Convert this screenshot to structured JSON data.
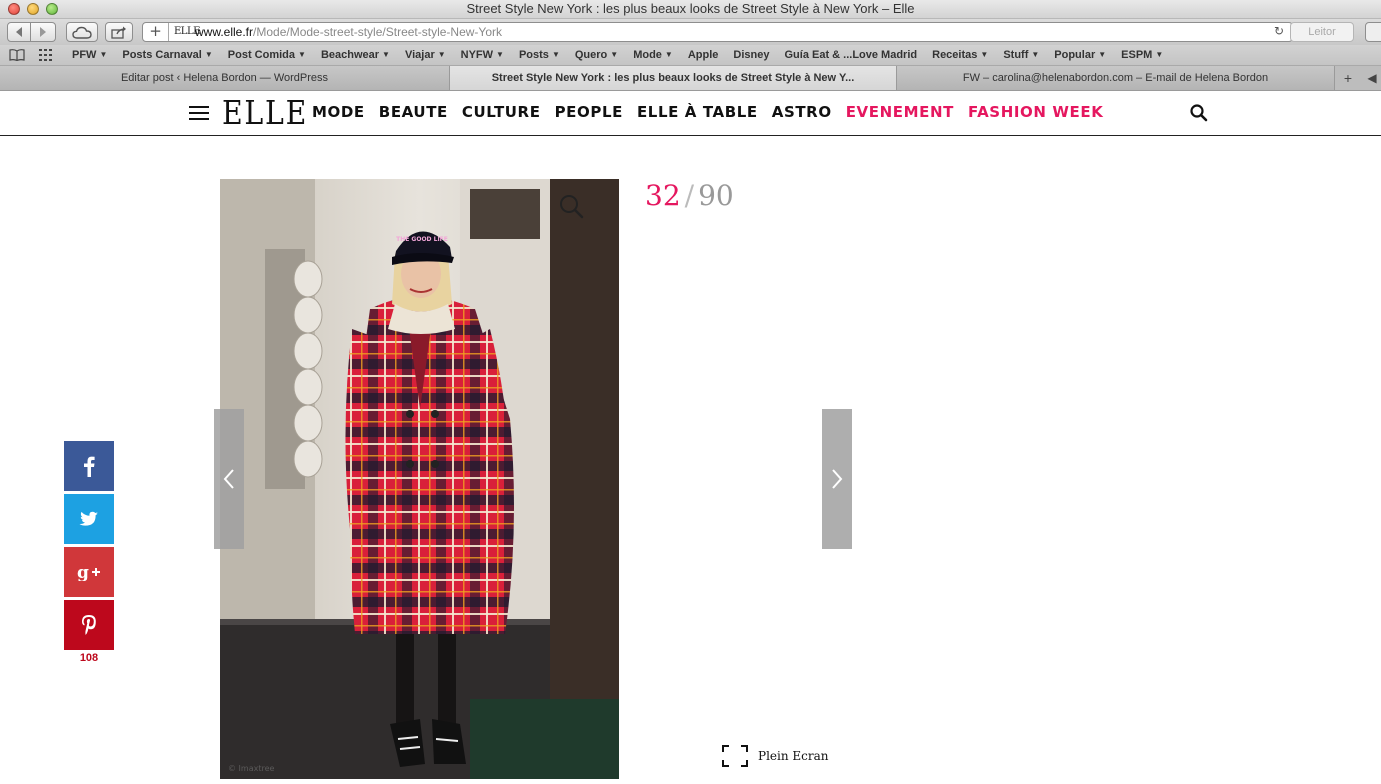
{
  "window": {
    "title": "Street Style New York : les plus beaux looks de Street Style à New York – Elle"
  },
  "browser": {
    "url_favicon": "ELLE",
    "url_domain": "www.elle.fr",
    "url_path": "/Mode/Mode-street-style/Street-style-New-York",
    "reader_label": "Leitor",
    "bookmarks": [
      {
        "label": "PFW",
        "menu": true
      },
      {
        "label": "Posts Carnaval",
        "menu": true
      },
      {
        "label": "Post Comida",
        "menu": true
      },
      {
        "label": "Beachwear",
        "menu": true
      },
      {
        "label": "Viajar",
        "menu": true
      },
      {
        "label": "NYFW",
        "menu": true
      },
      {
        "label": "Posts",
        "menu": true
      },
      {
        "label": "Quero",
        "menu": true
      },
      {
        "label": "Mode",
        "menu": true
      },
      {
        "label": "Apple",
        "menu": false
      },
      {
        "label": "Disney",
        "menu": false
      },
      {
        "label": "Guía Eat & ...Love Madrid",
        "menu": false
      },
      {
        "label": "Receitas",
        "menu": true
      },
      {
        "label": "Stuff",
        "menu": true
      },
      {
        "label": "Popular",
        "menu": true
      },
      {
        "label": "ESPM",
        "menu": true
      }
    ],
    "tabs": [
      {
        "label": "Editar post ‹ Helena Bordon — WordPress",
        "active": false
      },
      {
        "label": "Street Style New York : les plus beaux looks de Street Style à New Y...",
        "active": true
      },
      {
        "label": "FW – carolina@helenabordon.com – E-mail de Helena Bordon",
        "active": false
      }
    ]
  },
  "site": {
    "logo": "ELLE",
    "nav": [
      {
        "label": "MODE",
        "highlight": false
      },
      {
        "label": "BEAUTE",
        "highlight": false
      },
      {
        "label": "CULTURE",
        "highlight": false
      },
      {
        "label": "PEOPLE",
        "highlight": false
      },
      {
        "label": "ELLE À TABLE",
        "highlight": false
      },
      {
        "label": "ASTRO",
        "highlight": false
      },
      {
        "label": "EVENEMENT",
        "highlight": true
      },
      {
        "label": "FASHION WEEK",
        "highlight": true
      }
    ],
    "accent_color": "#e5175f"
  },
  "gallery": {
    "current": "32",
    "separator": "/",
    "total": "90",
    "fullscreen_label": "Plein Ecran",
    "photo_alt": "Street style look: woman in red tartan coat and black cap",
    "cap_text": "THE GOOD LIFE"
  },
  "share": {
    "pinterest_count": "108",
    "colors": {
      "facebook": "#3b5998",
      "twitter": "#1da1e2",
      "googleplus": "#d0373a",
      "pinterest": "#bd081c"
    }
  }
}
